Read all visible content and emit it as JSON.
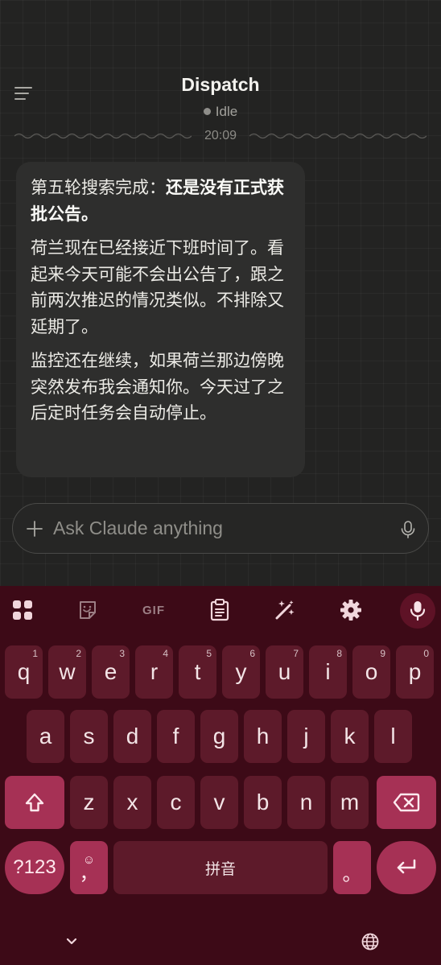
{
  "header": {
    "title": "Dispatch",
    "status": "Idle",
    "timestamp": "20:09"
  },
  "message": {
    "p1_prefix": "第五轮搜索完成：",
    "p1_bold": "还是没有正式获批公告。",
    "p2": "荷兰现在已经接近下班时间了。看起来今天可能不会出公告了，跟之前两次推迟的情况类似。不排除又延期了。",
    "p3": "监控还在继续，如果荷兰那边傍晚突然发布我会通知你。今天过了之后定时任务会自动停止。"
  },
  "composer": {
    "placeholder": "Ask Claude anything",
    "value": ""
  },
  "keyboard": {
    "toolbar": {
      "gif_label": "GIF"
    },
    "row1": [
      {
        "key": "q",
        "hint": "1"
      },
      {
        "key": "w",
        "hint": "2"
      },
      {
        "key": "e",
        "hint": "3"
      },
      {
        "key": "r",
        "hint": "4"
      },
      {
        "key": "t",
        "hint": "5"
      },
      {
        "key": "y",
        "hint": "6"
      },
      {
        "key": "u",
        "hint": "7"
      },
      {
        "key": "i",
        "hint": "8"
      },
      {
        "key": "o",
        "hint": "9"
      },
      {
        "key": "p",
        "hint": "0"
      }
    ],
    "row2": [
      "a",
      "s",
      "d",
      "f",
      "g",
      "h",
      "j",
      "k",
      "l"
    ],
    "row3": [
      "z",
      "x",
      "c",
      "v",
      "b",
      "n",
      "m"
    ],
    "symbols_label": "?123",
    "comma_label": "，",
    "comma_emoji": "☺",
    "space_label": "拼音",
    "period_label": "。"
  },
  "colors": {
    "chat_background": "#232322",
    "bubble": "#2e2e2d",
    "keyboard_background": "#3d0a17",
    "key": "#5d1a2a",
    "action_key": "#a63155"
  },
  "icons": {
    "menu": "hamburger-menu-icon",
    "composer_add": "plus-icon",
    "composer_mic": "microphone-icon",
    "toolbar": [
      "apps-grid-icon",
      "sticker-icon",
      "gif-icon",
      "clipboard-icon",
      "magic-wand-icon",
      "settings-gear-icon",
      "microphone-icon"
    ],
    "shift": "shift-arrow-icon",
    "backspace": "backspace-icon",
    "enter": "enter-return-icon",
    "hide_keyboard": "chevron-down-icon",
    "language": "globe-icon"
  }
}
